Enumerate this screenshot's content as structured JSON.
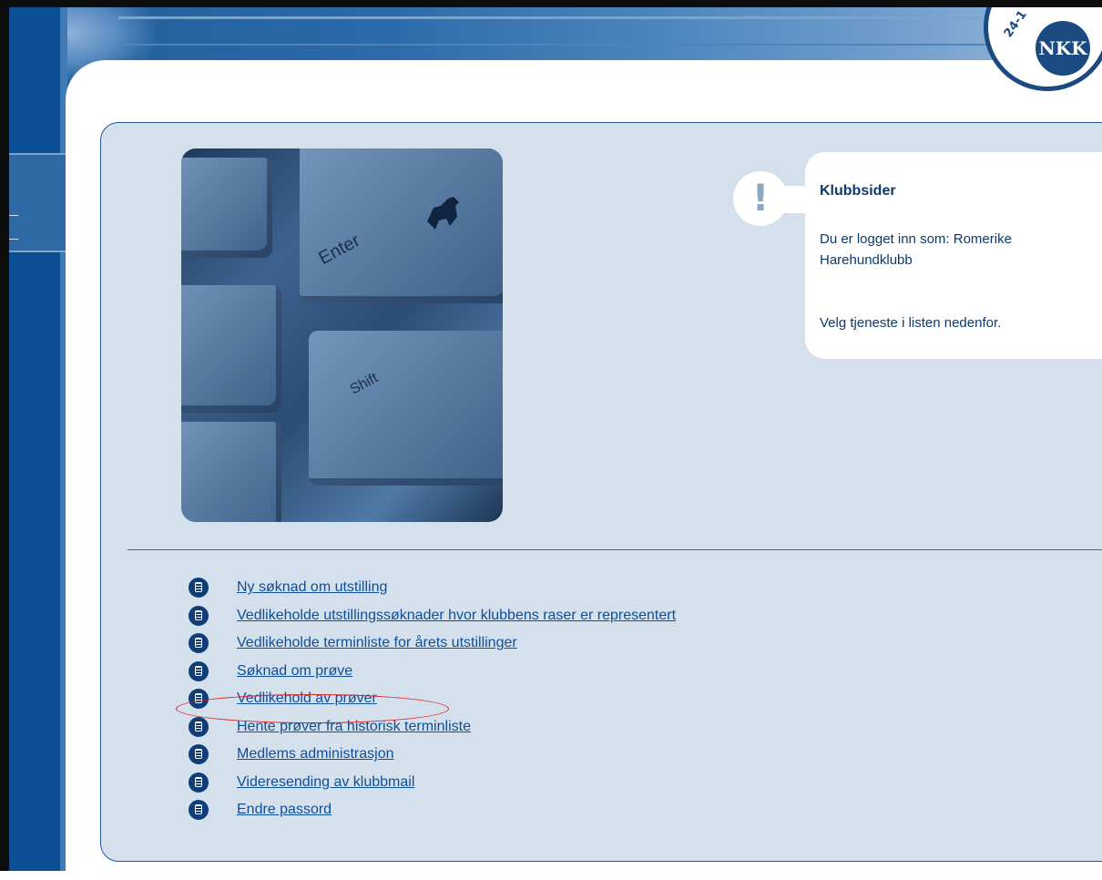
{
  "header": {
    "logo_text": "NKK",
    "logo_ring_text": "24-1"
  },
  "photo": {
    "keys": [
      "Enter",
      "Shift"
    ]
  },
  "info": {
    "title": "Klubbsider",
    "logged_in": "Du er logget inn som: Romerike Harehundklubb",
    "instruction": "Velg tjeneste i listen nedenfor."
  },
  "menu": {
    "items": [
      {
        "label": "Ny søknad om utstilling"
      },
      {
        "label": "Vedlikeholde utstillingssøknader hvor klubbens raser er representert"
      },
      {
        "label": "Vedlikeholde terminliste for årets utstillinger"
      },
      {
        "label": "Søknad om prøve"
      },
      {
        "label": "Vedlikehold av prøver"
      },
      {
        "label": "Hente prøver fra historisk terminliste"
      },
      {
        "label": "Medlems administrasjon"
      },
      {
        "label": "Videresending av klubbmail"
      },
      {
        "label": "Endre passord"
      }
    ],
    "highlighted": "Vedlikehold av prøver"
  },
  "colors": {
    "brand_blue": "#0a4f93",
    "panel": "#d4e0ec",
    "link": "#0f4f98",
    "highlight": "#d82020"
  }
}
